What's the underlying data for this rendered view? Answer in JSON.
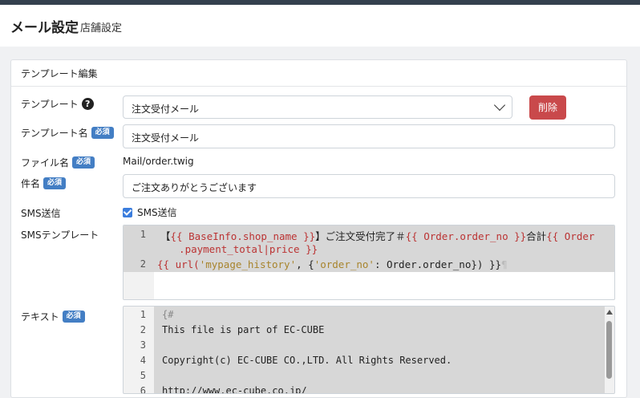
{
  "header": {
    "title": "メール設定",
    "breadcrumb": "店舗設定"
  },
  "card": {
    "title": "テンプレート編集"
  },
  "labels": {
    "template": "テンプレート",
    "template_name": "テンプレート名",
    "file_name": "ファイル名",
    "subject": "件名",
    "sms_send": "SMS送信",
    "sms_template": "SMSテンプレート",
    "text": "テキスト",
    "required": "必須"
  },
  "template_select": {
    "value": "注文受付メール"
  },
  "delete_button": "削除",
  "template_name_value": "注文受付メール",
  "file_name_value": "Mail/order.twig",
  "subject_value": "ご注文ありがとうございます",
  "sms_checkbox": {
    "label": "SMS送信",
    "checked": true
  },
  "sms_editor": {
    "line1_no": "1",
    "line1_a": "【",
    "line1_b": "{{ BaseInfo.shop_name }}",
    "line1_c": "】ご注文受付完了＃",
    "line1_d": "{{ Order.order_no }}",
    "line1_e": "合計",
    "line1_f": "{{ Order",
    "line1_wrap": "  .payment_total|price }}",
    "line2_no": "2",
    "line2_a": "{{ url(",
    "line2_b": "'mypage_history'",
    "line2_c": ", {",
    "line2_d": "'order_no'",
    "line2_e": ": Order.order_no}) }}",
    "line2_pilcrow": "¶"
  },
  "text_editor": {
    "lines": [
      {
        "no": "1",
        "text": "{#"
      },
      {
        "no": "2",
        "text": "This file is part of EC-CUBE"
      },
      {
        "no": "3",
        "text": ""
      },
      {
        "no": "4",
        "text": "Copyright(c) EC-CUBE CO.,LTD. All Rights Reserved."
      },
      {
        "no": "5",
        "text": ""
      },
      {
        "no": "6",
        "text": "http://www.ec-cube.co.jp/"
      }
    ]
  }
}
